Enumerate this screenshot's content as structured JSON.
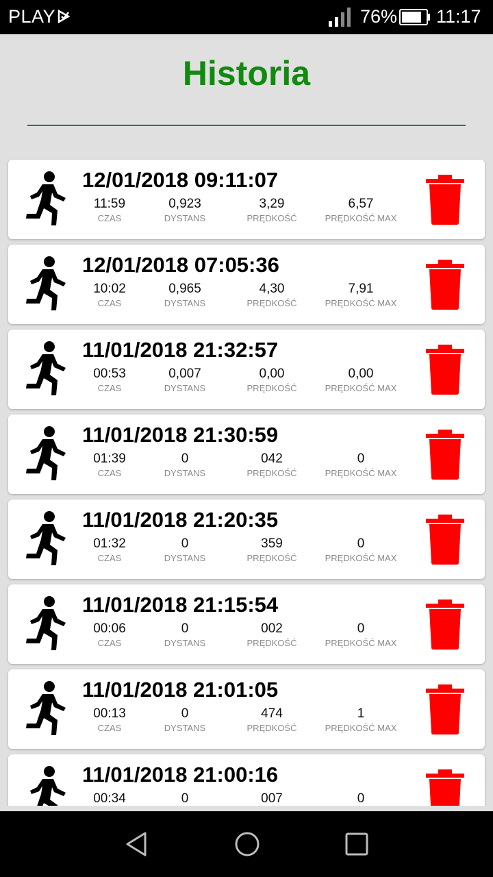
{
  "status_bar": {
    "carrier": "PLAY",
    "battery_percent": "76%",
    "time": "11:17"
  },
  "header": {
    "title": "Historia"
  },
  "labels": {
    "time": "CZAS",
    "distance": "DYSTANS",
    "speed": "PRĘDKOŚĆ",
    "max_speed": "PRĘDKOŚĆ MAX"
  },
  "colors": {
    "title": "#118a0f",
    "delete_icon": "#ff0000",
    "divider": "#2e6b6b"
  },
  "runs": [
    {
      "date": "12/01/2018 09:11:07",
      "time": "11:59",
      "distance": "0,923",
      "speed": "3,29",
      "max_speed": "6,57"
    },
    {
      "date": "12/01/2018 07:05:36",
      "time": "10:02",
      "distance": "0,965",
      "speed": "4,30",
      "max_speed": "7,91"
    },
    {
      "date": "11/01/2018 21:32:57",
      "time": "00:53",
      "distance": "0,007",
      "speed": "0,00",
      "max_speed": "0,00"
    },
    {
      "date": "11/01/2018 21:30:59",
      "time": "01:39",
      "distance": "0",
      "speed": "042",
      "max_speed": "0"
    },
    {
      "date": "11/01/2018 21:20:35",
      "time": "01:32",
      "distance": "0",
      "speed": "359",
      "max_speed": "0"
    },
    {
      "date": "11/01/2018 21:15:54",
      "time": "00:06",
      "distance": "0",
      "speed": "002",
      "max_speed": "0"
    },
    {
      "date": "11/01/2018 21:01:05",
      "time": "00:13",
      "distance": "0",
      "speed": "474",
      "max_speed": "1"
    },
    {
      "date": "11/01/2018 21:00:16",
      "time": "00:34",
      "distance": "0",
      "speed": "007",
      "max_speed": "0"
    }
  ]
}
